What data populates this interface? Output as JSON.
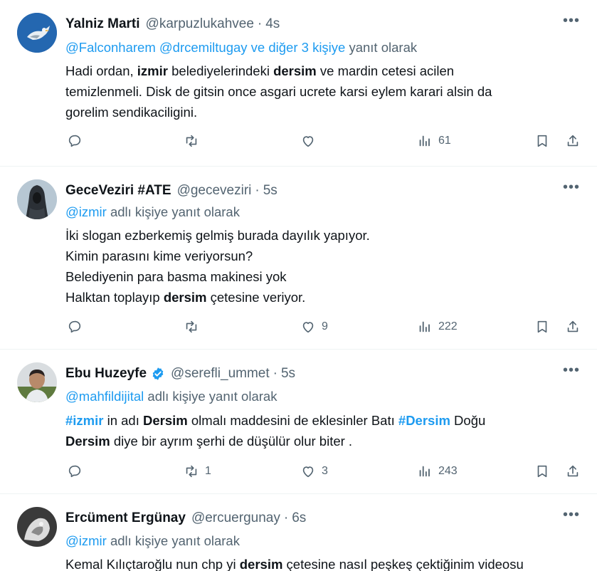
{
  "tweets": [
    {
      "name": "Yalniz Marti",
      "handle": "@karpuzlukahvee",
      "time": "4s",
      "verified": false,
      "avatar": "seagull-avatar",
      "reply": {
        "mentions": "@Falconharem @drcemiltugay  ve diğer 3 kişiye",
        "suffix": " yanıt olarak"
      },
      "body_lines": [
        [
          {
            "t": "Hadi ordan, "
          },
          {
            "t": "izmir",
            "b": true
          },
          {
            "t": " belediyelerindeki "
          },
          {
            "t": "dersim",
            "b": true
          },
          {
            "t": " ve mardin cetesi acilen"
          }
        ],
        [
          {
            "t": "temizlenmeli. Disk de gitsin once asgari ucrete karsi eylem karari alsin da"
          }
        ],
        [
          {
            "t": "gorelim sendikaciligini."
          }
        ]
      ],
      "replies": "",
      "retweets": "",
      "likes": "",
      "views": "61"
    },
    {
      "name": "GeceVeziri #ATE",
      "handle": "@geceveziri",
      "time": "5s",
      "verified": false,
      "avatar": "hooded-figure-avatar",
      "reply": {
        "mentions": "@izmir",
        "suffix": " adlı kişiye yanıt olarak"
      },
      "body_lines": [
        [
          {
            "t": "İki slogan ezberkemiş gelmiş burada dayılık yapıyor."
          }
        ],
        [
          {
            "t": "Kimin parasını kime veriyorsun?"
          }
        ],
        [
          {
            "t": "Belediyenin para basma makinesi yok"
          }
        ],
        [
          {
            "t": "Halktan toplayıp "
          },
          {
            "t": "dersim",
            "b": true
          },
          {
            "t": " çetesine veriyor."
          }
        ]
      ],
      "replies": "",
      "retweets": "",
      "likes": "9",
      "views": "222"
    },
    {
      "name": "Ebu Huzeyfe",
      "handle": "@serefli_ummet",
      "time": "5s",
      "verified": true,
      "avatar": "man-portrait-avatar",
      "reply": {
        "mentions": "@mahfildijital",
        "suffix": " adlı kişiye yanıt olarak"
      },
      "body_lines": [
        [
          {
            "t": "#izmir",
            "tag": true
          },
          {
            "t": " in adı "
          },
          {
            "t": "Dersim",
            "b": true
          },
          {
            "t": " olmalı maddesini de eklesinler Batı "
          },
          {
            "t": "#Dersim",
            "tag": true
          },
          {
            "t": " Doğu"
          }
        ],
        [
          {
            "t": "Dersim",
            "b": true
          },
          {
            "t": " diye bir ayrım şerhi de düşülür olur biter ."
          }
        ]
      ],
      "replies": "",
      "retweets": "1",
      "likes": "3",
      "views": "243"
    },
    {
      "name": "Ercüment Ergünay",
      "handle": "@ercuergunay",
      "time": "6s",
      "verified": false,
      "avatar": "monochrome-avatar",
      "reply": {
        "mentions": "@izmir",
        "suffix": " adlı kişiye yanıt olarak"
      },
      "body_lines": [
        [
          {
            "t": "Kemal Kılıçtaroğlu nun chp yi "
          },
          {
            "t": "dersim",
            "b": true
          },
          {
            "t": " çetesine nasıl peşkeş çektiğinim videosu"
          }
        ]
      ],
      "replies": "",
      "retweets": "",
      "likes": "",
      "views": ""
    }
  ],
  "colors": {
    "text": "#0f1419",
    "secondary": "#536471",
    "accent": "#1d9bf0",
    "divider": "#eff3f4"
  },
  "icons": {
    "more": "more-horizontal-icon",
    "reply": "comment-icon",
    "retweet": "retweet-icon",
    "like": "heart-icon",
    "views": "views-bar-chart-icon",
    "bookmark": "bookmark-icon",
    "share": "share-icon",
    "verified": "verified-badge-icon"
  }
}
